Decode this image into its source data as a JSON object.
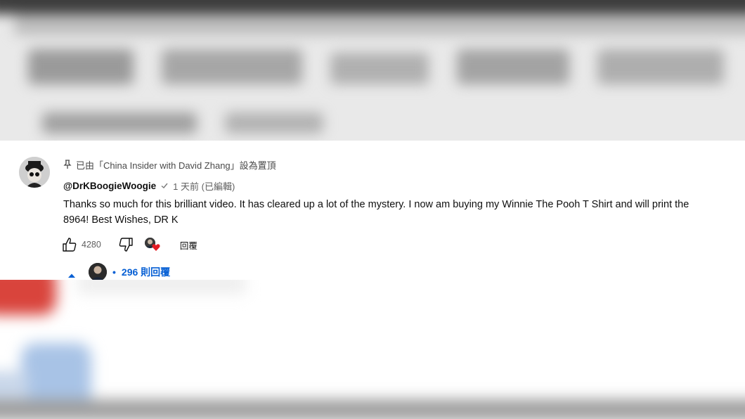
{
  "pinned": {
    "text": "已由「China Insider with David Zhang」設為置頂",
    "icon": "pin-icon"
  },
  "comment": {
    "author": "@DrKBoogieWoogie",
    "verified_icon": "checkmark-icon",
    "time": "1 天前 (已編輯)",
    "text": "Thanks so much for this brilliant video. It has cleared up a lot of the mystery. I now am buying my Winnie The Pooh T Shirt and will print the 8964! Best Wishes, DR K",
    "like_count": "4280",
    "reply_label": "回覆"
  },
  "replies": {
    "count_text": "296 則回覆",
    "color": "#065fd4"
  },
  "colors": {
    "heart": "#e31b23",
    "link": "#065fd4",
    "text": "#0f0f0f",
    "meta": "#606060"
  }
}
